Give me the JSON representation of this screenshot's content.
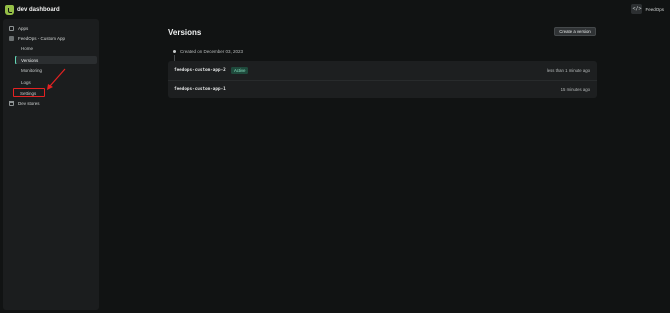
{
  "header": {
    "brand": "dev dashboard",
    "user_avatar_glyph": "</>",
    "user_name": "FeedOps"
  },
  "sidebar": {
    "apps_label": "Apps",
    "app_name": "FeedOps - Custom App",
    "items": [
      {
        "label": "Home"
      },
      {
        "label": "Versions",
        "active": true
      },
      {
        "label": "Monitoring"
      },
      {
        "label": "Logs"
      },
      {
        "label": "Settings",
        "highlighted": true
      }
    ],
    "dev_stores_label": "Dev stores"
  },
  "main": {
    "title": "Versions",
    "create_button": "Create a version",
    "created_text": "Created on December 03, 2023",
    "versions": [
      {
        "name": "feedops-custom-app-2",
        "badge": "Active",
        "time": "less than 1 minute ago"
      },
      {
        "name": "feedops-custom-app-1",
        "badge": "",
        "time": "15 minutes ago"
      }
    ]
  },
  "colors": {
    "background": "#111313",
    "sidebar": "#1b1d1e",
    "accent_active": "#63d8b7",
    "badge_bg": "#1f4a3c",
    "annotation_red": "#e52222",
    "brand_green": "#95bf47"
  }
}
